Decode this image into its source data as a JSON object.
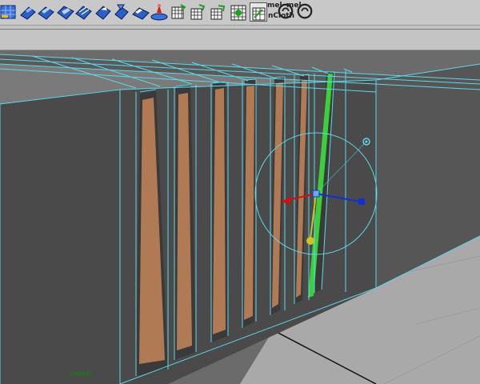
{
  "shelf": {
    "mel_label_1": "mel",
    "mel_label_2": "mel",
    "ncloth_label": "nCloth"
  },
  "viewport": {
    "camera_label": "persp"
  },
  "colors": {
    "wireframe": "#5fd7e8",
    "selected_edge": "#3ccf3c",
    "axis_x": "#d01010",
    "axis_z": "#1030d0",
    "axis_y": "#d0c020",
    "groove_fill": "#b07a55",
    "wall": "#4a4a4a",
    "floor": "#a9a9a9"
  }
}
